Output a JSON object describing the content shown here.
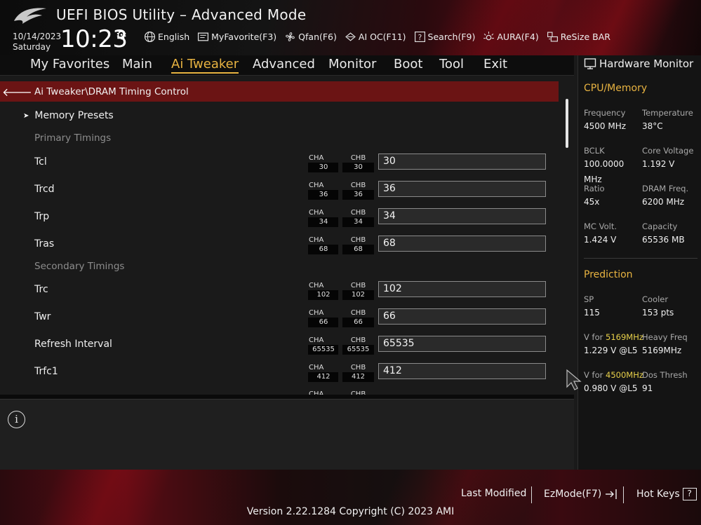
{
  "header": {
    "title": "UEFI BIOS Utility – Advanced Mode",
    "date": "10/14/2023",
    "day": "Saturday",
    "time": "10:23",
    "toolbar": [
      {
        "label": "English",
        "icon": "globe-icon"
      },
      {
        "label": "MyFavorite(F3)",
        "icon": "favorite-icon"
      },
      {
        "label": "Qfan(F6)",
        "icon": "fan-icon"
      },
      {
        "label": "AI OC(F11)",
        "icon": "ai-oc-icon"
      },
      {
        "label": "Search(F9)",
        "icon": "search-icon"
      },
      {
        "label": "AURA(F4)",
        "icon": "aura-icon"
      },
      {
        "label": "ReSize BAR",
        "icon": "resize-bar-icon"
      }
    ]
  },
  "nav": {
    "tabs": [
      "My Favorites",
      "Main",
      "Ai Tweaker",
      "Advanced",
      "Monitor",
      "Boot",
      "Tool",
      "Exit"
    ],
    "active": "Ai Tweaker"
  },
  "breadcrumb": "Ai Tweaker\\DRAM Timing Control",
  "menu": {
    "presets": "Memory Presets",
    "primary_section": "Primary Timings",
    "secondary_section": "Secondary Timings",
    "rows": [
      {
        "label": "Tcl",
        "cha": "30",
        "chb": "30",
        "value": "30"
      },
      {
        "label": "Trcd",
        "cha": "36",
        "chb": "36",
        "value": "36"
      },
      {
        "label": "Trp",
        "cha": "34",
        "chb": "34",
        "value": "34"
      },
      {
        "label": "Tras",
        "cha": "68",
        "chb": "68",
        "value": "68"
      },
      {
        "label": "Trc",
        "cha": "102",
        "chb": "102",
        "value": "102"
      },
      {
        "label": "Twr",
        "cha": "66",
        "chb": "66",
        "value": "66"
      },
      {
        "label": "Refresh Interval",
        "cha": "65535",
        "chb": "65535",
        "value": "65535"
      },
      {
        "label": "Trfc1",
        "cha": "412",
        "chb": "412",
        "value": "412"
      }
    ],
    "cha_label": "CHA",
    "chb_label": "CHB"
  },
  "hardware_monitor": {
    "title": "Hardware Monitor",
    "cpu_memory_title": "CPU/Memory",
    "cpu_memory": [
      {
        "key": "Frequency",
        "value": "4500 MHz"
      },
      {
        "key": "Temperature",
        "value": "38°C"
      },
      {
        "key": "BCLK",
        "value": "100.0000 MHz"
      },
      {
        "key": "Core Voltage",
        "value": "1.192 V"
      },
      {
        "key": "Ratio",
        "value": "45x"
      },
      {
        "key": "DRAM Freq.",
        "value": "6200 MHz"
      },
      {
        "key": "MC Volt.",
        "value": "1.424 V"
      },
      {
        "key": "Capacity",
        "value": "65536 MB"
      }
    ],
    "prediction_title": "Prediction",
    "prediction": {
      "sp_key": "SP",
      "sp_value": "115",
      "cooler_key": "Cooler",
      "cooler_value": "153 pts",
      "v1_prefix": "V for ",
      "v1_freq": "5169MHz",
      "v1_value": "1.229 V @L5",
      "heavy_key": "Heavy Freq",
      "heavy_value": "5169MHz",
      "v2_prefix": "V for ",
      "v2_freq": "4500MHz",
      "v2_value": "0.980 V @L5",
      "dos_key": "Dos Thresh",
      "dos_value": "91"
    }
  },
  "footer": {
    "last_modified": "Last Modified",
    "ezmode": "EzMode(F7)",
    "hotkeys": "Hot Keys",
    "hotkeys_glyph": "?",
    "version": "Version 2.22.1284 Copyright (C) 2023 AMI"
  },
  "colors": {
    "accent": "#e8b341",
    "breadcrumb_bg": "#6b1414",
    "highlight_freq": "#e8d04a"
  }
}
